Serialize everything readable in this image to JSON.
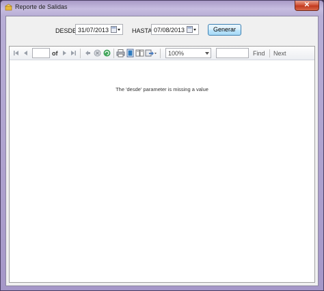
{
  "window": {
    "title": "Reporte de Salidas",
    "close_glyph": "✕",
    "accent": "#a99ac7"
  },
  "params": {
    "desde_label": "DESDE",
    "desde_value": "31/07/2013",
    "hasta_label": "HASTA",
    "hasta_value": "07/08/2013",
    "generate_label": "Generar"
  },
  "toolbar": {
    "page_number": "",
    "of_label": "of",
    "zoom_value": "100%",
    "find_value": "",
    "find_label": "Find",
    "next_label": "Next"
  },
  "report": {
    "message": "The 'desde' parameter is missing a value"
  }
}
